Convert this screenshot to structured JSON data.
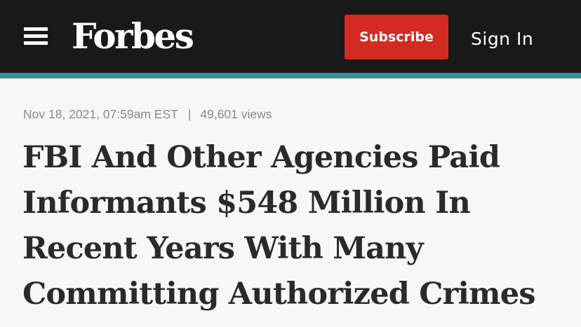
{
  "header": {
    "logo_text": "Forbes",
    "subscribe_label": "Subscribe",
    "signin_label": "Sign In",
    "colors": {
      "bar": "#191919",
      "accent_rule": "#3a8e9b",
      "subscribe": "#d32a22"
    }
  },
  "article": {
    "date": "Nov 18, 2021, 07:59am EST",
    "separator": "|",
    "views": "49,601 views",
    "headline_lines": [
      "FBI And Other Agencies Paid",
      "Informants $548 Million In",
      "Recent Years With Many",
      "Committing Authorized Crimes"
    ]
  }
}
